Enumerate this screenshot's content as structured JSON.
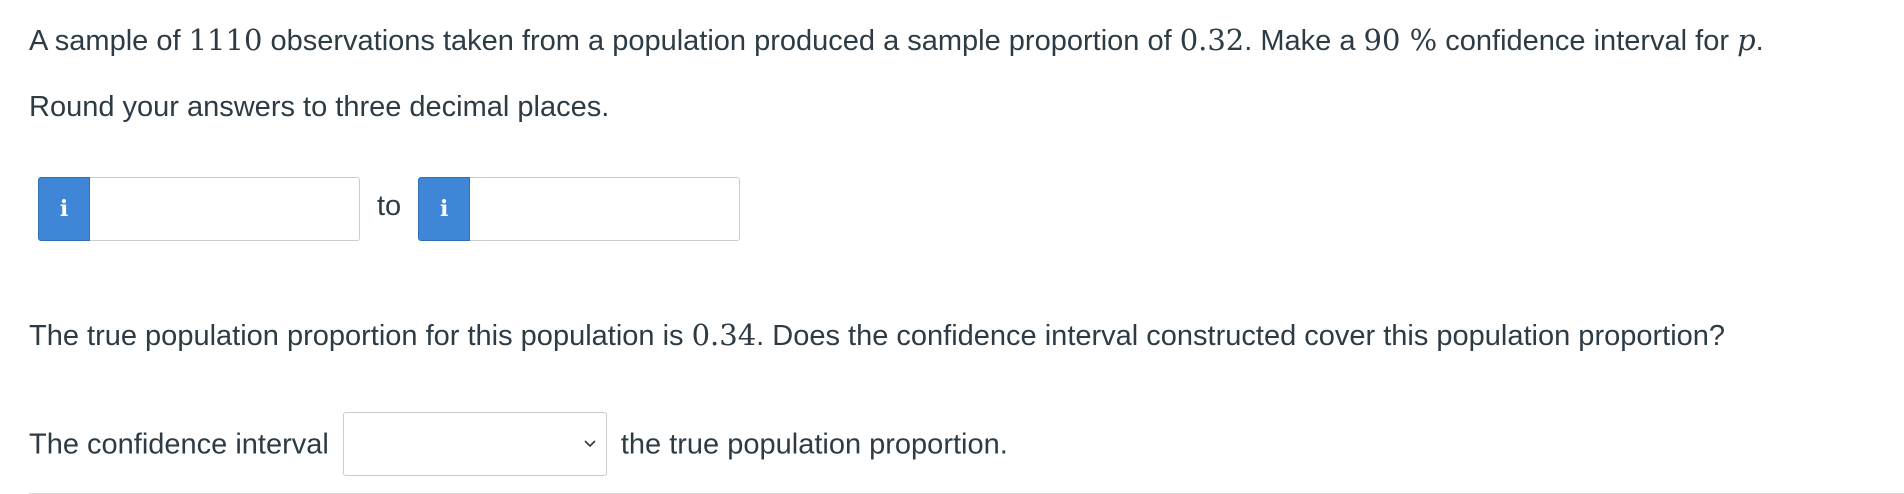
{
  "question": {
    "part1_prefix": "A sample of ",
    "sample_size": "1110",
    "part1_mid": " observations taken from a population produced a sample proportion of ",
    "sample_proportion": "0.32",
    "part1_mid2": ". Make a ",
    "confidence_level": "90",
    "percent_sign": " %",
    "part1_suffix": "  confidence interval for ",
    "param": "p",
    "part1_end": ".",
    "instructions": "Round your answers to three decimal places."
  },
  "interval_inputs": {
    "info_glyph": "i",
    "lower_value": "",
    "to_label": "to",
    "upper_value": ""
  },
  "followup": {
    "part_prefix": "The true population proportion for this population is ",
    "true_proportion": "0.34",
    "part_suffix": ". Does the confidence interval constructed cover this population proportion?"
  },
  "answer_sentence": {
    "prefix": "The confidence interval",
    "selected_value": "",
    "suffix": "the true population proportion."
  },
  "icons": {
    "info": "info-icon",
    "dropdown": "chevron-down-icon"
  },
  "colors": {
    "text": "#2d3b45",
    "info_button": "#3f86d6",
    "border": "#c7cdd1"
  }
}
